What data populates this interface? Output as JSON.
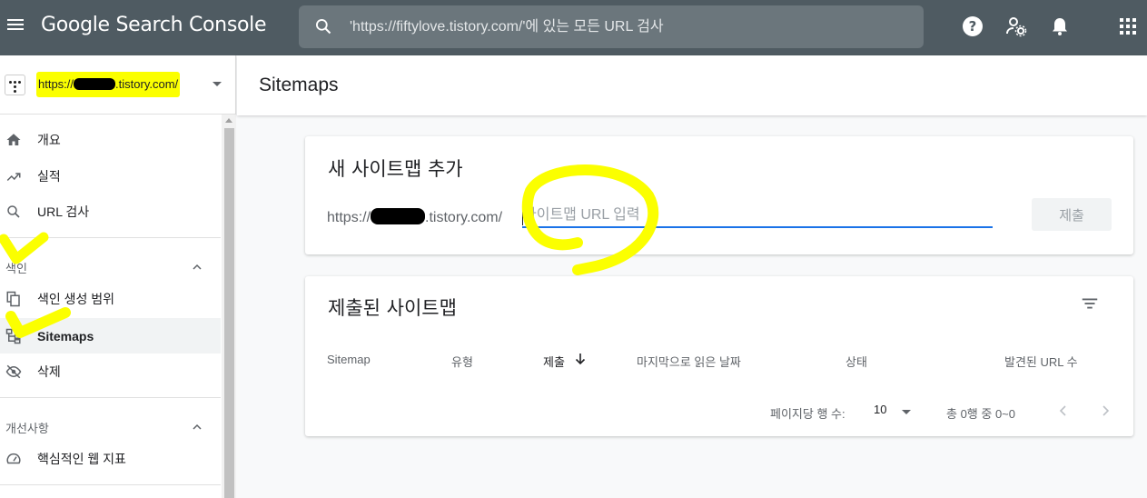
{
  "app": {
    "title": "Google Search Console"
  },
  "search": {
    "placeholder": "'https://fiftylove.tistory.com/'에 있는 모든 URL 검사"
  },
  "property": {
    "url_prefix": "https://",
    "url_suffix": ".tistory.com/"
  },
  "sidebar": {
    "items": [
      {
        "label": "개요",
        "icon": "home-icon"
      },
      {
        "label": "실적",
        "icon": "trending-up-icon"
      },
      {
        "label": "URL 검사",
        "icon": "search-icon"
      }
    ],
    "index_section": {
      "title": "색인",
      "items": [
        {
          "label": "색인 생성 범위",
          "icon": "file-copy-icon"
        },
        {
          "label": "Sitemaps",
          "icon": "sitemap-icon",
          "active": true
        },
        {
          "label": "삭제",
          "icon": "visibility-off-icon"
        }
      ]
    },
    "enhancements_section": {
      "title": "개선사항",
      "items": [
        {
          "label": "핵심적인 웹 지표",
          "icon": "speed-icon"
        }
      ]
    }
  },
  "main": {
    "page_title": "Sitemaps",
    "add_card": {
      "title": "새 사이트맵 추가",
      "prefix_start": "https://",
      "prefix_end": ".tistory.com/",
      "input_placeholder": "사이트맵 URL 입력",
      "submit_label": "제출"
    },
    "submitted_card": {
      "title": "제출된 사이트맵",
      "columns": [
        "Sitemap",
        "유형",
        "제출",
        "마지막으로 읽은 날짜",
        "상태",
        "발견된 URL 수"
      ],
      "sorted_column": "제출",
      "rows": [],
      "rows_per_page_label": "페이지당 행 수:",
      "rows_per_page": "10",
      "range_label": "총 0행 중 0~0"
    }
  },
  "colors": {
    "appbar": "#4f5b62",
    "accent": "#1a73e8",
    "highlight": "#fbff00"
  }
}
